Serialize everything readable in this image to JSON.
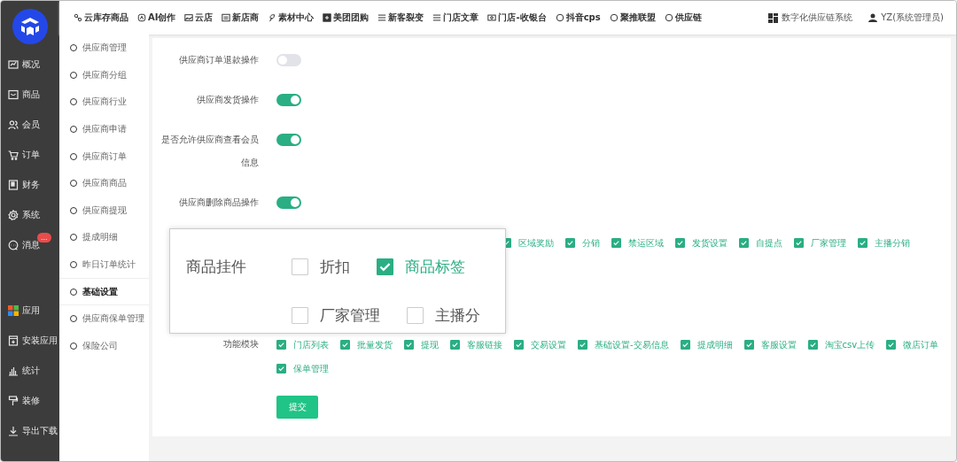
{
  "top_nav": [
    {
      "label": "云库存商品"
    },
    {
      "label": "AI创作"
    },
    {
      "label": "云店"
    },
    {
      "label": "新店商"
    },
    {
      "label": "素材中心"
    },
    {
      "label": "美团团购"
    },
    {
      "label": "新客裂变"
    },
    {
      "label": "门店文章"
    },
    {
      "label": "门店-收银台"
    },
    {
      "label": "抖音cps"
    },
    {
      "label": "聚推联盟"
    },
    {
      "label": "供应链"
    }
  ],
  "system_name": "数字化供应链系统",
  "user": "YZ(系统管理员)",
  "main_menu": [
    {
      "label": "概况"
    },
    {
      "label": "商品"
    },
    {
      "label": "会员"
    },
    {
      "label": "订单"
    },
    {
      "label": "财务"
    },
    {
      "label": "系统"
    },
    {
      "label": "消息",
      "badge": "..."
    }
  ],
  "app_menu": [
    {
      "label": "应用"
    },
    {
      "label": "安装应用"
    },
    {
      "label": "统计"
    },
    {
      "label": "装修"
    },
    {
      "label": "导出下载"
    }
  ],
  "sub_menu": [
    {
      "label": "供应商管理",
      "selected": false
    },
    {
      "label": "供应商分组",
      "selected": false
    },
    {
      "label": "供应商行业",
      "selected": false
    },
    {
      "label": "供应商申请",
      "selected": false
    },
    {
      "label": "供应商订单",
      "selected": false
    },
    {
      "label": "供应商商品",
      "selected": false
    },
    {
      "label": "供应商提现",
      "selected": false
    },
    {
      "label": "提成明细",
      "selected": false
    },
    {
      "label": "昨日订单统计",
      "selected": false
    },
    {
      "label": "基础设置",
      "selected": true
    },
    {
      "label": "供应商保单管理",
      "selected": false
    },
    {
      "label": "保险公司",
      "selected": false
    }
  ],
  "toggles": [
    {
      "label": "供应商订单退款操作",
      "on": false
    },
    {
      "label": "供应商发货操作",
      "on": true
    },
    {
      "label": "是否允许供应商查看会员信息",
      "on": true
    },
    {
      "label": "供应商删除商品操作",
      "on": true
    }
  ],
  "feature_groups": [
    {
      "items": [
        {
          "label": "区域奖励",
          "checked": true
        },
        {
          "label": "分销",
          "checked": true
        },
        {
          "label": "禁运区域",
          "checked": true
        },
        {
          "label": "发货设置",
          "checked": true
        },
        {
          "label": "自提点",
          "checked": true
        },
        {
          "label": "厂家管理",
          "checked": true
        },
        {
          "label": "主播分销",
          "checked": true
        }
      ]
    },
    {
      "label": "功能模块",
      "items": [
        {
          "label": "门店列表",
          "checked": true
        },
        {
          "label": "批量发货",
          "checked": true
        },
        {
          "label": "提现",
          "checked": true
        },
        {
          "label": "客服链接",
          "checked": true
        },
        {
          "label": "交易设置",
          "checked": true
        },
        {
          "label": "基础设置-交易信息",
          "checked": true
        },
        {
          "label": "提成明细",
          "checked": true
        },
        {
          "label": "客服设置",
          "checked": true
        },
        {
          "label": "淘宝csv上传",
          "checked": true
        },
        {
          "label": "微店订单",
          "checked": true
        },
        {
          "label": "保单管理",
          "checked": true
        }
      ]
    }
  ],
  "submit": "提交",
  "zoom_popup": {
    "label": "商品挂件",
    "items": [
      {
        "label": "折扣",
        "checked": false
      },
      {
        "label": "商品标签",
        "checked": true
      },
      {
        "label": "厂家管理",
        "checked": false
      },
      {
        "label": "主播分",
        "checked": false
      }
    ]
  }
}
